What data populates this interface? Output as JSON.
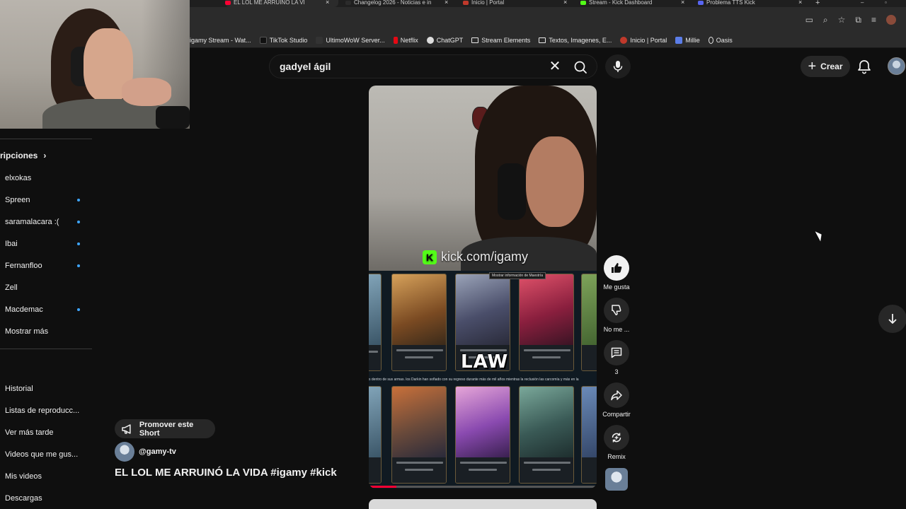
{
  "browser": {
    "tabs": [
      {
        "title": "EL LOL ME ARRUINÓ LA VI",
        "favicon_color": "#ff0033",
        "active": true
      },
      {
        "title": "Changelog 2026 - Noticias e in",
        "favicon_color": "#2b2b2b",
        "active": false
      },
      {
        "title": "Inicio | Portal",
        "favicon_color": "#c0392b",
        "active": false
      },
      {
        "title": "Stream - Kick Dashboard",
        "favicon_color": "#53fc18",
        "active": false
      },
      {
        "title": "Problema TTS Kick",
        "favicon_color": "#5865f2",
        "active": false
      }
    ],
    "new_tab_symbol": "+",
    "bookmarks": [
      {
        "label": "igamy Stream - Wat...",
        "icon": "page-icon",
        "color": "#444"
      },
      {
        "label": "TikTok Studio",
        "icon": "tiktok-icon",
        "color": "#111"
      },
      {
        "label": "UltimoWoW Server...",
        "icon": "page-icon",
        "color": "#333"
      },
      {
        "label": "Netflix",
        "icon": "netflix-icon",
        "color": "#e50914"
      },
      {
        "label": "ChatGPT",
        "icon": "chatgpt-icon",
        "color": "#ddd"
      },
      {
        "label": "Stream Elements",
        "icon": "folder-icon",
        "color": "folder"
      },
      {
        "label": "Textos, Imagenes, E...",
        "icon": "folder-icon",
        "color": "folder"
      },
      {
        "label": "Inicio | Portal",
        "icon": "portal-icon",
        "color": "#c0392b"
      },
      {
        "label": "Millie",
        "icon": "millie-icon",
        "color": "#5b7de8"
      },
      {
        "label": "Oasis",
        "icon": "oasis-icon",
        "color": "outline"
      }
    ]
  },
  "search": {
    "value": "gadyel ágil"
  },
  "header": {
    "create_label": "Crear"
  },
  "sidebar": {
    "subscriptions_heading": "ripciones",
    "subscriptions": [
      {
        "label": "elxokas",
        "new": false
      },
      {
        "label": "Spreen",
        "new": true
      },
      {
        "label": "saramalacara :(",
        "new": true
      },
      {
        "label": "Ibai",
        "new": true
      },
      {
        "label": "Fernanfloo",
        "new": true
      },
      {
        "label": "Zell",
        "new": false
      },
      {
        "label": "Macdemac",
        "new": true
      }
    ],
    "show_more": "Mostrar más",
    "you_items": [
      "Historial",
      "Listas de reproducc...",
      "Ver más tarde",
      "Videos que me gus...",
      "Mis videos",
      "Descargas"
    ],
    "accent_color": "#3ea6ff"
  },
  "short": {
    "kick_url": "kick.com/igamy",
    "kick_logo_letter": "K",
    "tooltip": "Mostrar información de Maestría",
    "watermark": "LAW",
    "lore_text": "s dentro de sus armas. los Darkin han soñado con su regreso durante más de mil años mientras la reclusión las carcomía y más en la",
    "progress": 0.12,
    "progress_color": "#ff0033",
    "promote_label": "Promover este Short",
    "channel": "@gamy-tv",
    "title": "EL LOL ME ARRUINÓ LA VIDA #igamy #kick"
  },
  "actions": {
    "like_label": "Me gusta",
    "dislike_label": "No me ...",
    "comments_count": "3",
    "share_label": "Compartir",
    "remix_label": "Remix"
  }
}
